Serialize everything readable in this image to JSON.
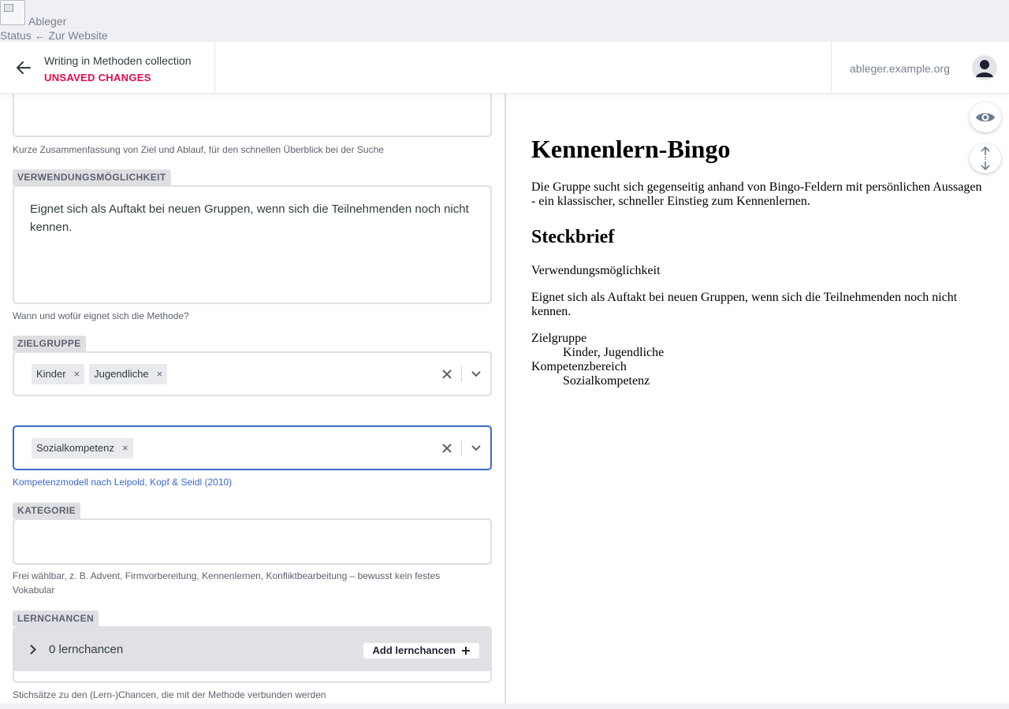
{
  "site": {
    "title": "Ableger",
    "links": "Status ← Zur Website"
  },
  "header": {
    "title": "Writing in Methoden collection",
    "status": "UNSAVED CHANGES",
    "site_url": "ableger.example.org",
    "icons": {
      "back": "arrow-left-icon",
      "avatar": "user-icon"
    }
  },
  "editor": {
    "summary_hint": "Kurze Zusammenfassung von Ziel und Ablauf, für den schnellen Überblick bei der Suche",
    "usage": {
      "label": "VERWENDUNGSMÖGLICHKEIT",
      "value": "Eignet sich als Auftakt bei neuen Gruppen, wenn sich die Teilnehmenden noch nicht kennen.",
      "hint": "Wann und wofür eignet sich die Methode?"
    },
    "target_group": {
      "label": "ZIELGRUPPE",
      "tags": [
        "Kinder",
        "Jugendliche"
      ]
    },
    "competence": {
      "tags": [
        "Sozialkompetenz"
      ],
      "hint": "Kompetenzmodell nach Leipold, Kopf & Seidl (2010)"
    },
    "category": {
      "label": "KATEGORIE",
      "value": "",
      "hint": "Frei wählbar, z. B. Advent, Firmvorbereitung, Kennenlernen, Konfliktbearbeitung – bewusst kein festes Vokabular"
    },
    "learning": {
      "label": "LERNCHANCEN",
      "count": "0 lernchancen",
      "add_label": "Add lernchancen",
      "hint": "Stichsätze zu den (Lern-)Chancen, die mit der Methode verbunden werden"
    },
    "tag_remove": "×"
  },
  "preview": {
    "title": "Kennenlern-Bingo",
    "summary": "Die Gruppe sucht sich gegenseitig anhand von Bingo-Feldern mit persönlichen Aussagen - ein klassischer, schneller Einstieg zum Kennenlernen.",
    "section": "Steckbrief",
    "usage_label": "Verwendungsmöglichkeit",
    "usage_value": "Eignet sich als Auftakt bei neuen Gruppen, wenn sich die Teilnehmenden noch nicht kennen.",
    "target_label": "Zielgruppe",
    "target_value": "Kinder, Jugendliche",
    "competence_label": "Kompetenzbereich",
    "competence_value": "Sozialkompetenz"
  },
  "colors": {
    "accent": "#3a69c7",
    "unsaved": "#e20c4b",
    "label_bg": "#dfdfe3"
  }
}
